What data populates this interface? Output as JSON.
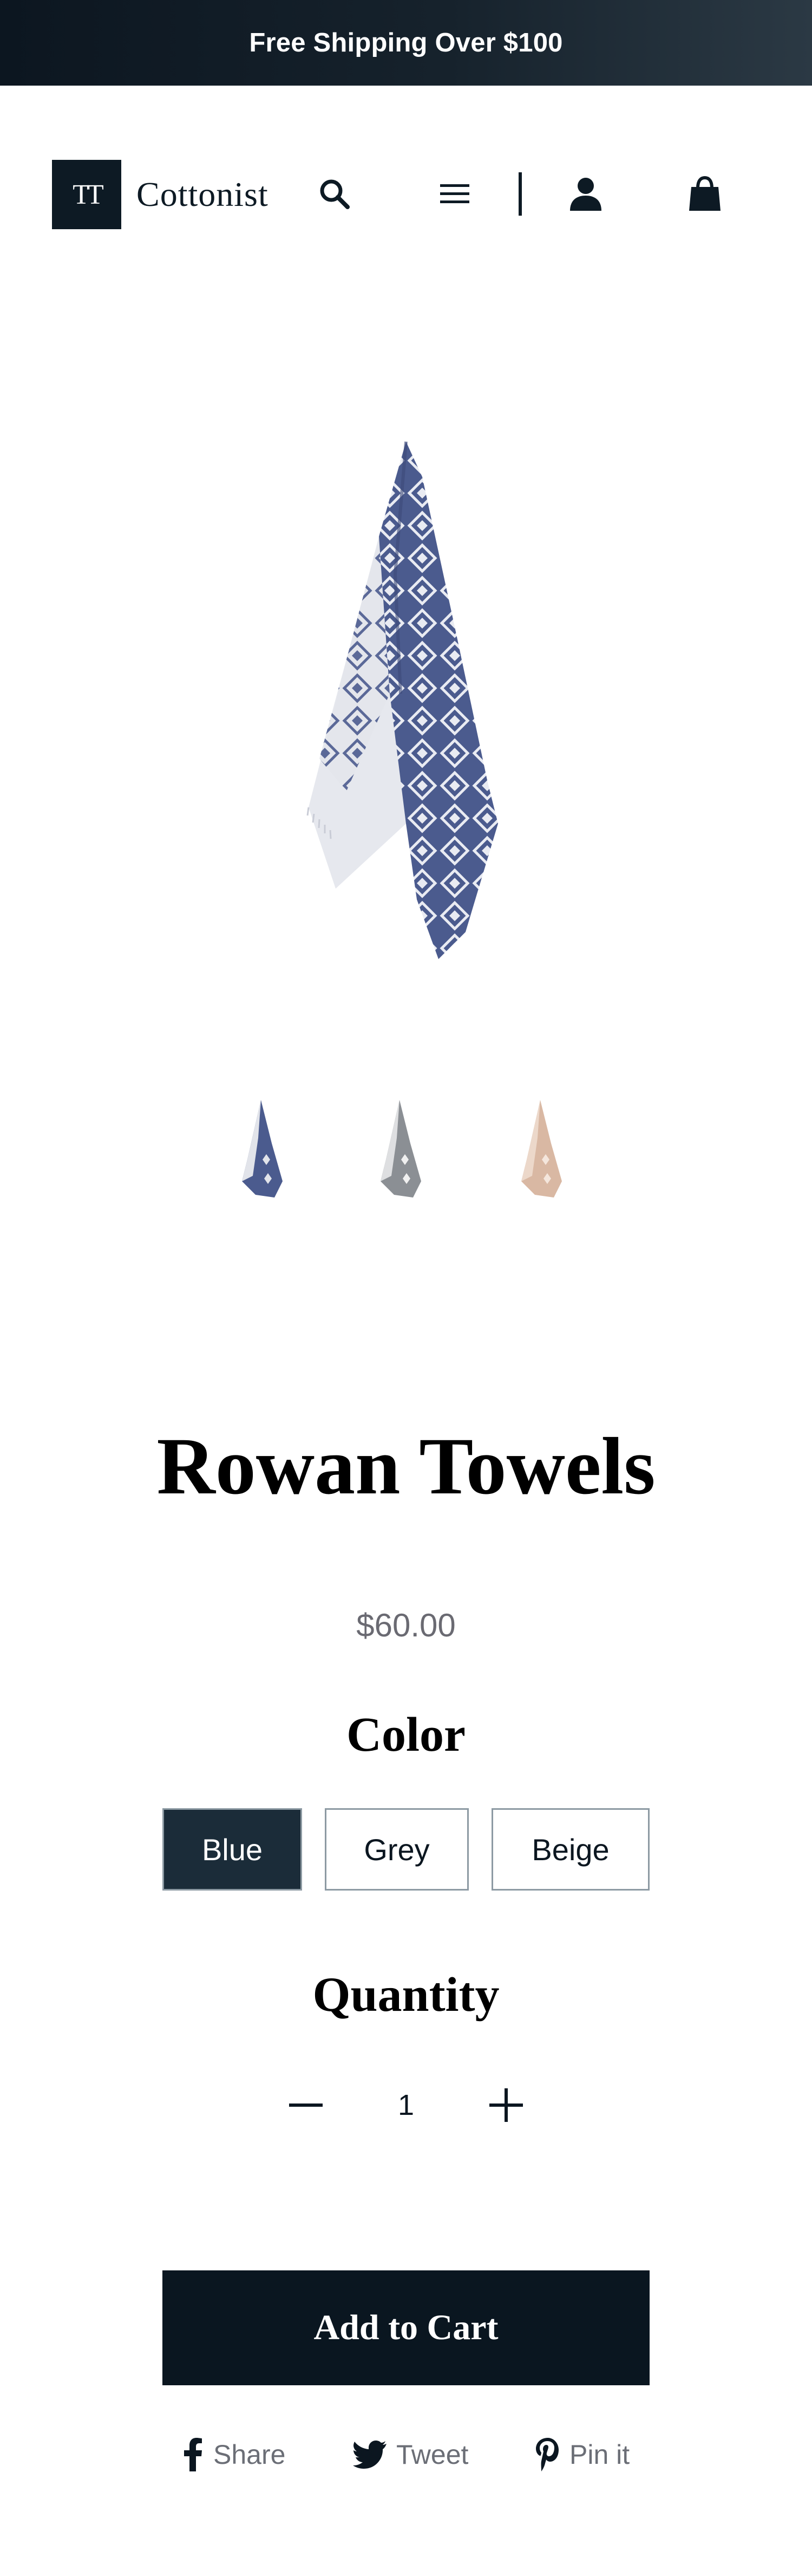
{
  "announcement": {
    "text": "Free Shipping Over $100"
  },
  "header": {
    "logo_mark": "TT",
    "logo_text": "Cottonist",
    "icons": [
      "search-icon",
      "menu-icon",
      "account-icon",
      "cart-icon"
    ]
  },
  "gallery": {
    "thumbnails": [
      "Blue",
      "Grey",
      "Beige"
    ]
  },
  "product": {
    "title": "Rowan Towels",
    "price": "$60.00",
    "color_label": "Color",
    "colors": [
      {
        "label": "Blue",
        "selected": true
      },
      {
        "label": "Grey",
        "selected": false
      },
      {
        "label": "Beige",
        "selected": false
      }
    ],
    "quantity_label": "Quantity",
    "quantity": "1",
    "add_to_cart": "Add to Cart"
  },
  "share": {
    "facebook": "Share",
    "twitter": "Tweet",
    "pinterest": "Pin it"
  },
  "colors": {
    "announcement_bg": "#0c1620",
    "primary": "#0a1620",
    "selected_swatch": "#1b2c39",
    "price_text": "#6a6a72",
    "towel_blue": "#4b5b8e",
    "towel_grey": "#8b8f94",
    "towel_beige": "#d9b8a3"
  }
}
